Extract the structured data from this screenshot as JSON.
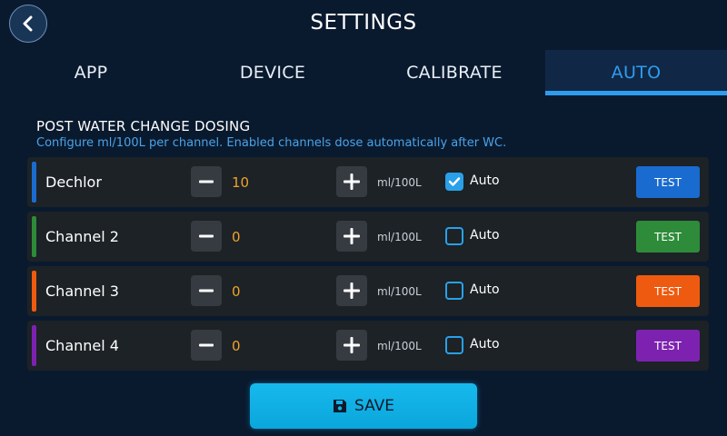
{
  "header": {
    "title": "SETTINGS",
    "back_icon": "chevron-left-icon"
  },
  "tabs": [
    {
      "label": "APP",
      "active": false
    },
    {
      "label": "DEVICE",
      "active": false
    },
    {
      "label": "CALIBRATE",
      "active": false
    },
    {
      "label": "AUTO",
      "active": true
    }
  ],
  "section": {
    "title": "POST WATER CHANGE DOSING",
    "subtitle": "Configure ml/100L per channel. Enabled channels dose automatically after WC."
  },
  "channels": [
    {
      "name": "Dechlor",
      "value": "10",
      "unit": "ml/100L",
      "auto_label": "Auto",
      "auto": true,
      "test_label": "TEST",
      "color": "#1a6bd0"
    },
    {
      "name": "Channel 2",
      "value": "0",
      "unit": "ml/100L",
      "auto_label": "Auto",
      "auto": false,
      "test_label": "TEST",
      "color": "#2e8b3a"
    },
    {
      "name": "Channel 3",
      "value": "0",
      "unit": "ml/100L",
      "auto_label": "Auto",
      "auto": false,
      "test_label": "TEST",
      "color": "#ee5a0f"
    },
    {
      "name": "Channel 4",
      "value": "0",
      "unit": "ml/100L",
      "auto_label": "Auto",
      "auto": false,
      "test_label": "TEST",
      "color": "#7d22b0"
    }
  ],
  "save": {
    "label": "SAVE",
    "icon": "floppy-disk-icon"
  },
  "colors": {
    "background": "#0a1a2e",
    "accent": "#2f9cf0",
    "value": "#f0a12b",
    "save": "#10b0e6"
  }
}
